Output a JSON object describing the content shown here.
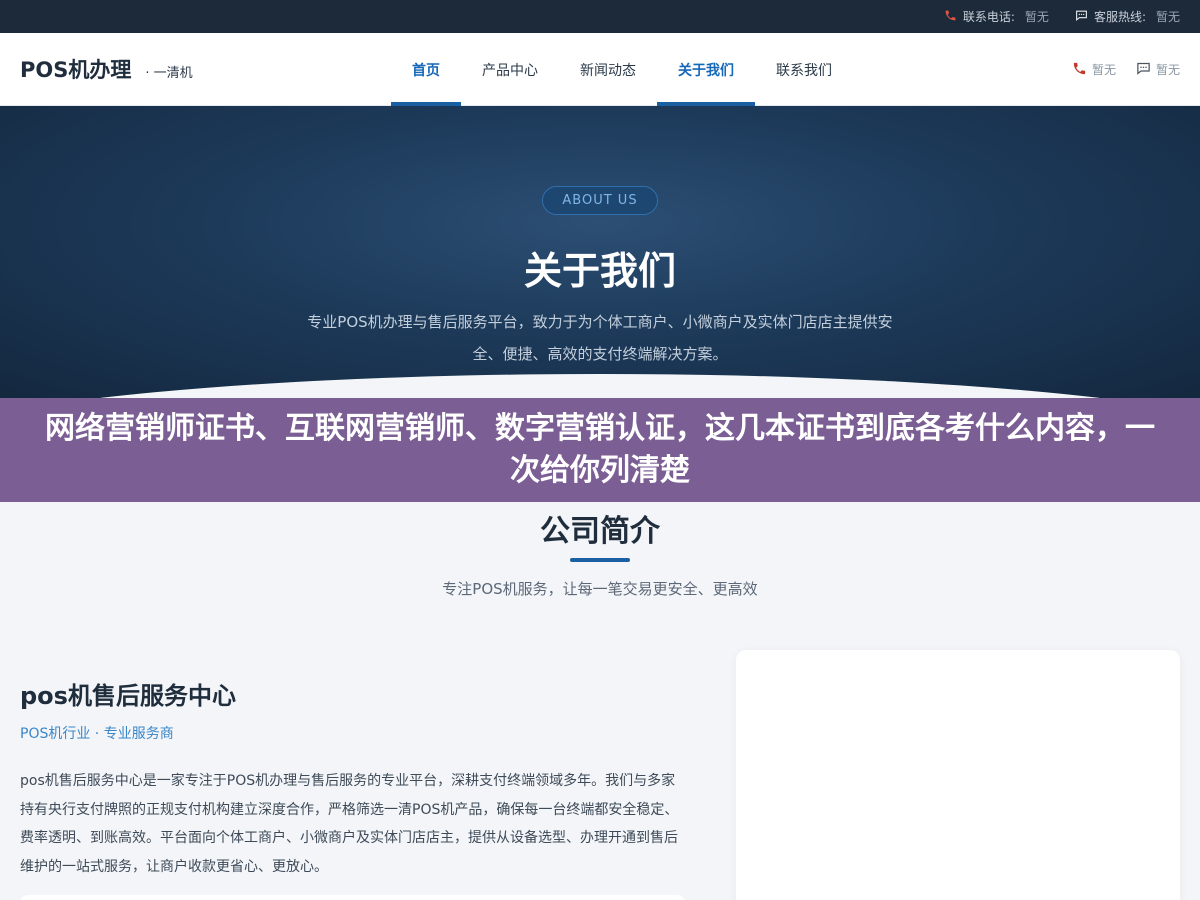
{
  "topbar": {
    "phone_label": "联系电话:",
    "phone_value": "暂无",
    "hotline_label": "客服热线:",
    "hotline_value": "暂无"
  },
  "header": {
    "brand_name": "POS机办理",
    "brand_sub": "· 一清机",
    "nav": [
      {
        "label": "首页",
        "active": true
      },
      {
        "label": "产品中心",
        "active": false
      },
      {
        "label": "新闻动态",
        "active": false
      },
      {
        "label": "关于我们",
        "active": true
      },
      {
        "label": "联系我们",
        "active": false
      }
    ],
    "phone_value": "暂无",
    "chat_value": "暂无"
  },
  "hero": {
    "badge": "ABOUT US",
    "title": "关于我们",
    "desc": "专业POS机办理与售后服务平台，致力于为个体工商户、小微商户及实体门店店主提供安全、便捷、高效的支付终端解决方案。"
  },
  "banner": {
    "text": "网络营销师证书、互联网营销师、数字营销认证，这几本证书到底各考什么内容，一次给你列清楚"
  },
  "section": {
    "title": "公司简介",
    "subtitle": "专注POS机服务，让每一笔交易更安全、更高效"
  },
  "company": {
    "title": "pos机售后服务中心",
    "tag": "POS机行业 · 专业服务商",
    "desc": "pos机售后服务中心是一家专注于POS机办理与售后服务的专业平台，深耕支付终端领域多年。我们与多家持有央行支付牌照的正规支付机构建立深度合作，严格筛选一清POS机产品，确保每一台终端都安全稳定、费率透明、到账高效。平台面向个体工商户、小微商户及实体门店店主，提供从设备选型、办理开通到售后维护的一站式服务，让商户收款更省心、更放心。"
  },
  "colors": {
    "accent": "#1b5fa3",
    "banner": "#7a5e94",
    "hero": "#1d3a5a",
    "phone_icon": "#c0392b"
  }
}
